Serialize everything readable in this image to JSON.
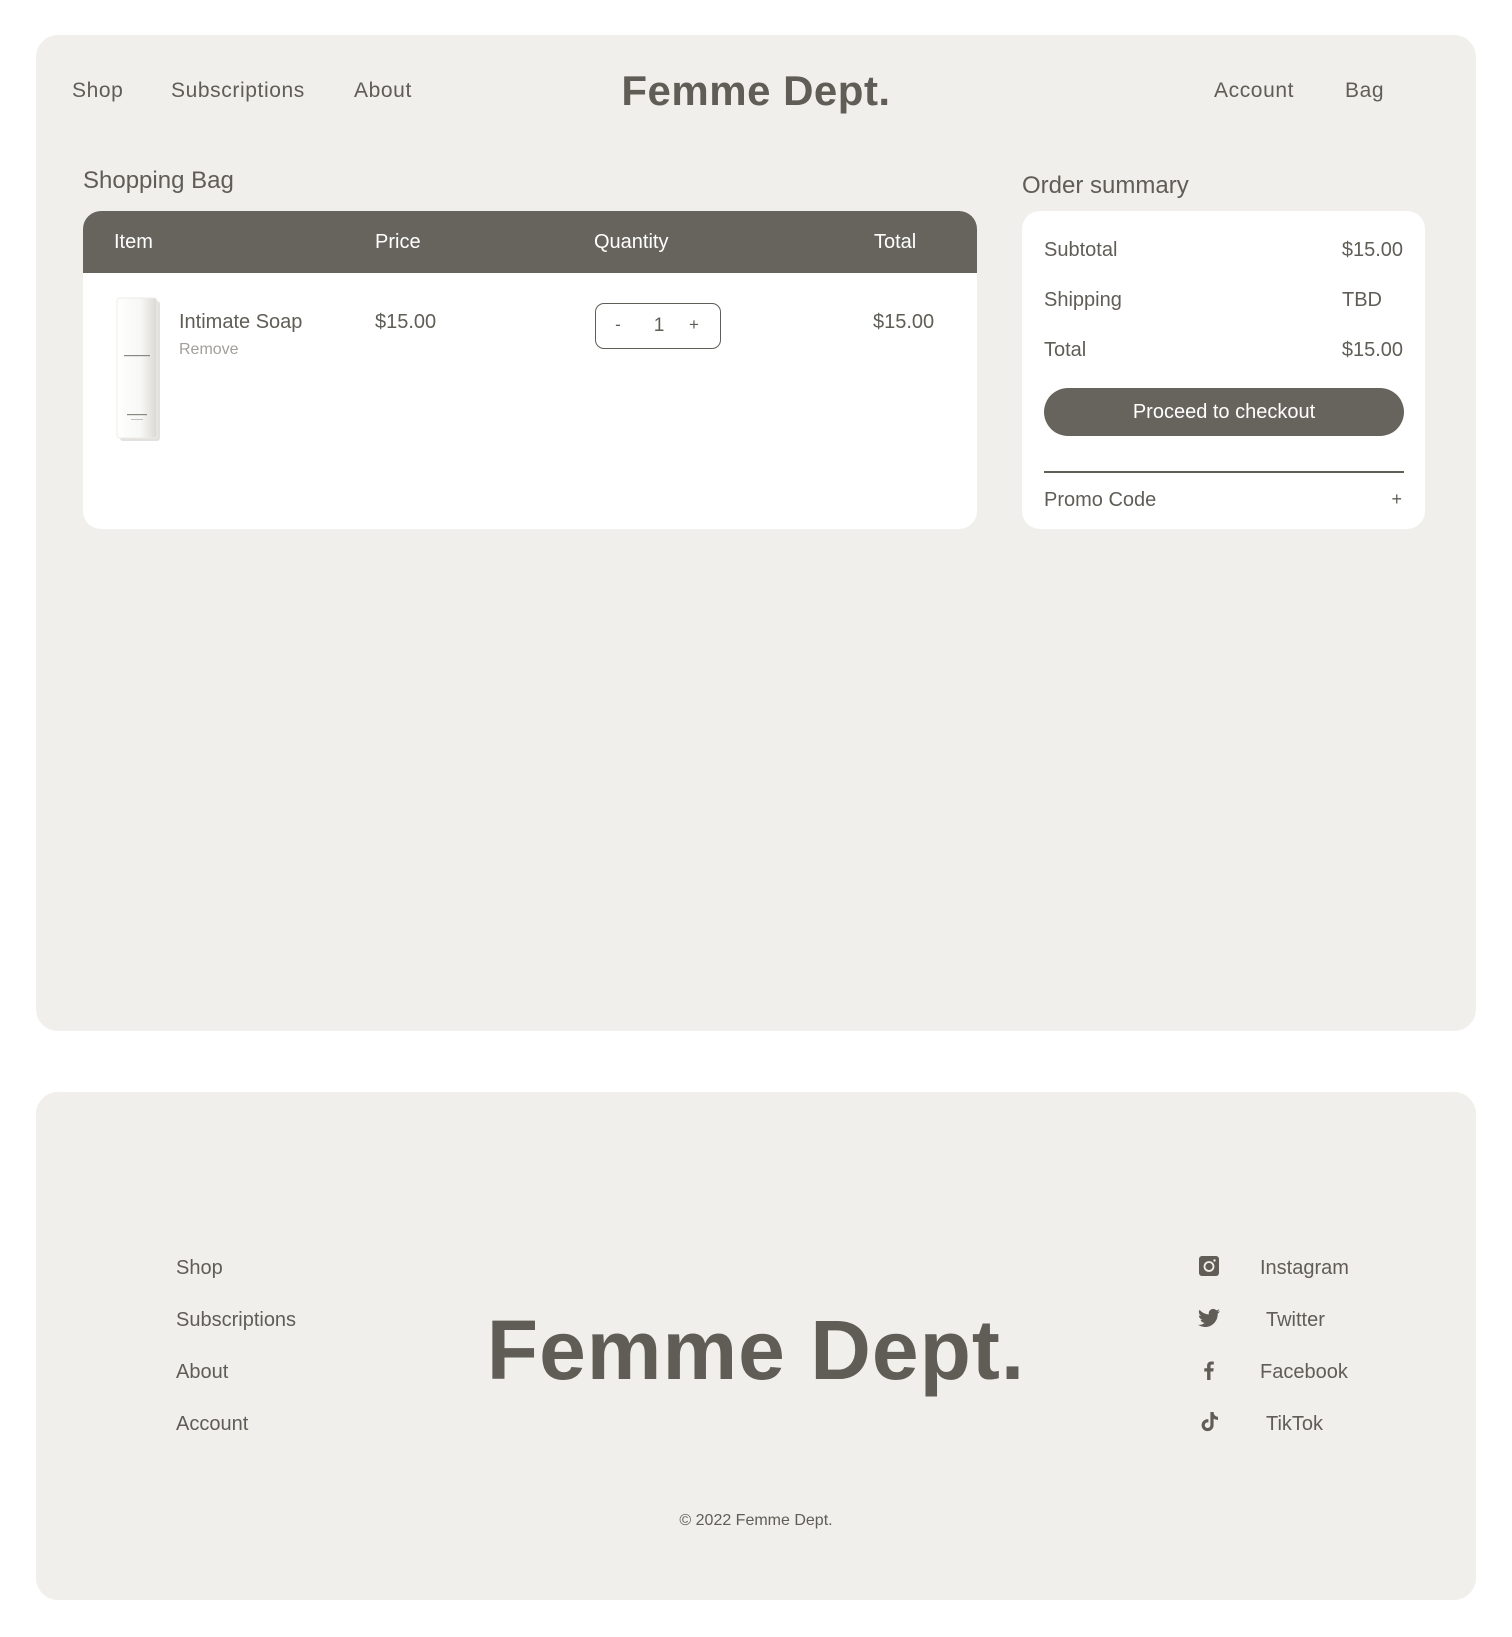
{
  "header": {
    "nav_left": [
      "Shop",
      "Subscriptions",
      "About"
    ],
    "logo": "Femme Dept.",
    "nav_right": [
      "Account",
      "Bag"
    ]
  },
  "bag": {
    "title": "Shopping Bag",
    "columns": [
      "Item",
      "Price",
      "Quantity",
      "Total"
    ],
    "items": [
      {
        "name": "Intimate Soap",
        "remove_label": "Remove",
        "price": "$15.00",
        "quantity": "1",
        "decrement": "-",
        "increment": "+",
        "total": "$15.00",
        "image_icon": "soap-bottle-image"
      }
    ]
  },
  "summary": {
    "title": "Order summary",
    "rows": [
      {
        "label": "Subtotal",
        "value": "$15.00"
      },
      {
        "label": "Shipping",
        "value": "TBD"
      },
      {
        "label": "Total",
        "value": "$15.00"
      }
    ],
    "checkout_label": "Proceed to checkout",
    "promo_label": "Promo Code",
    "promo_icon": "+"
  },
  "footer": {
    "links": [
      "Shop",
      "Subscriptions",
      "About",
      "Account"
    ],
    "logo": "Femme Dept.",
    "social": [
      {
        "label": "Instagram",
        "icon": "instagram-icon"
      },
      {
        "label": "Twitter",
        "icon": "twitter-icon"
      },
      {
        "label": "Facebook",
        "icon": "facebook-icon"
      },
      {
        "label": "TikTok",
        "icon": "tiktok-icon"
      }
    ],
    "copyright": "© 2022 Femme Dept."
  },
  "colors": {
    "panel_bg": "#f0efeb",
    "accent_dark": "#66645d",
    "text": "#5f5d56",
    "muted": "#a19f98"
  }
}
